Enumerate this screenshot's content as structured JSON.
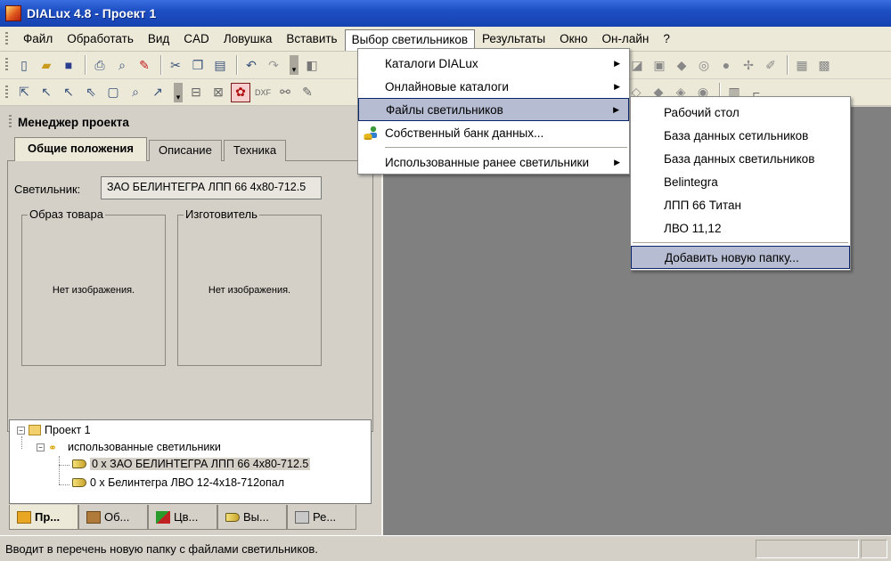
{
  "window": {
    "title": "DIALux 4.8 - Проект 1"
  },
  "menubar": [
    {
      "label": "Файл"
    },
    {
      "label": "Обработать"
    },
    {
      "label": "Вид"
    },
    {
      "label": "CAD"
    },
    {
      "label": "Ловушка"
    },
    {
      "label": "Вставить"
    },
    {
      "label": "Выбор светильников"
    },
    {
      "label": "Результаты"
    },
    {
      "label": "Окно"
    },
    {
      "label": "Он-лайн"
    },
    {
      "label": "?"
    }
  ],
  "luminaire_menu": {
    "items": [
      {
        "label": "Каталоги DIALux",
        "submenu": true
      },
      {
        "label": "Онлайновые каталоги",
        "submenu": true
      },
      {
        "label": "Файлы светильников",
        "submenu": true,
        "highlighted": true
      },
      {
        "label": "Собственный банк данных...",
        "icon": "user-database-icon"
      },
      {
        "label": "Использованные ранее светильники",
        "submenu": true
      }
    ]
  },
  "files_submenu": {
    "items": [
      {
        "label": "Рабочий стол"
      },
      {
        "label": "База данных сетильников"
      },
      {
        "label": "База данных светильников"
      },
      {
        "label": "Belintegra"
      },
      {
        "label": "ЛПП 66 Титан"
      },
      {
        "label": "ЛВО 11,12"
      },
      {
        "label": "Добавить новую папку...",
        "highlighted": true
      }
    ]
  },
  "project_manager": {
    "title": "Менеджер проекта",
    "tabs": [
      "Общие положения",
      "Описание",
      "Техника"
    ],
    "luminaire_label": "Светильник:",
    "luminaire_value": "ЗАО БЕЛИНТЕГРА ЛПП 66 4x80-712.5",
    "product_image_title": "Образ товара",
    "manufacturer_title": "Изготовитель",
    "no_image_text": "Нет изображения."
  },
  "tree": {
    "root": "Проект 1",
    "group": "использованные светильники",
    "items": [
      "0 x ЗАО БЕЛИНТЕГРА ЛПП 66 4x80-712.5",
      "0 x Белинтегра ЛВО 12-4x18-712опал"
    ]
  },
  "bottom_tabs": [
    "Пр...",
    "Об...",
    "Цв...",
    "Вы...",
    "Ре..."
  ],
  "statusbar": {
    "text": "Вводит в перечень новую папку с файлами светильников."
  }
}
